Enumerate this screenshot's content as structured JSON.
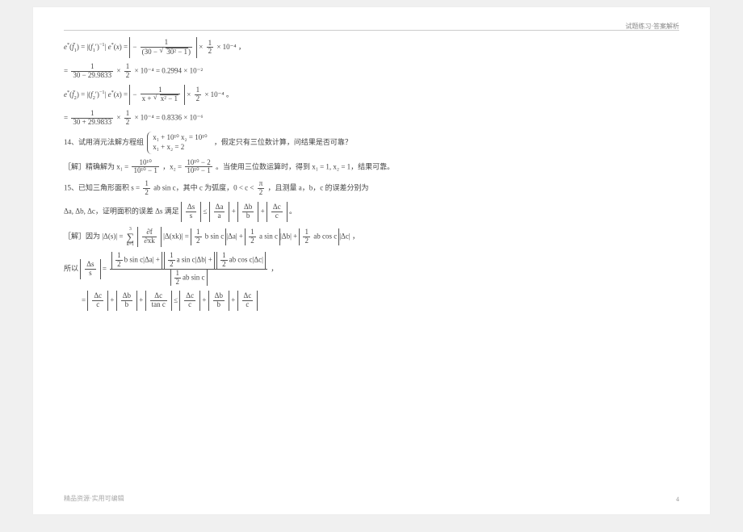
{
  "header": {
    "right": "试题练习·答案解析"
  },
  "footer": {
    "left": "精品资源·实用可编辑",
    "page": "4"
  },
  "eq1": {
    "lhs_a": "e",
    "lhs_sup_a": "*",
    "lhs_arg_a": "(f̄₁)",
    "mid_a": "= |(f₁')⁻¹| e",
    "mid_sup": "*",
    "mid_b": "(x) =",
    "big_num": "1",
    "big_den_a": "(30 − ",
    "big_den_sqrt": "30² − 1",
    "big_den_b": ")",
    "times": "×",
    "half_num": "1",
    "half_den": "2",
    "tenexp": "× 10⁻⁴",
    "punct": "，"
  },
  "eq1b": {
    "eq": "=",
    "f1_num": "1",
    "f1_den": "30 − 29.9833",
    "times": "×",
    "half_num": "1",
    "half_den": "2",
    "t4": "× 10⁻⁴ = 0.2994 × 10⁻²"
  },
  "eq2": {
    "lhs": "e*(f̄₂) = |(f₂')⁻¹| e*(x) =",
    "big_num": "1",
    "big_den_a": "x + ",
    "big_den_sqrt": "x² − 1",
    "times": "×",
    "half_num": "1",
    "half_den": "2",
    "tenexp": "× 10⁻⁴",
    "punct": "。"
  },
  "eq2b": {
    "eq": "=",
    "f1_num": "1",
    "f1_den": "30 + 29.9833",
    "times": "×",
    "half_num": "1",
    "half_den": "2",
    "t4": "× 10⁻⁴ = 0.8336 × 10⁻⁶"
  },
  "q14": {
    "label": "14、试用消元法解方程组",
    "sys_r1": "x₁ + 10¹⁰ x₂ = 10¹⁰",
    "sys_r2": "x₁ + x₂ = 2",
    "tail": "，假定只有三位数计算，问结果是否可靠？"
  },
  "a14": {
    "head": "［解］精确解为 x₁ =",
    "f1_num": "10¹⁰",
    "f1_den": "10¹⁰ − 1",
    "comma": "，x₂ =",
    "f2_num": "10¹⁰ − 2",
    "f2_den": "10¹⁰ − 1",
    "mid": "。当使用三位数运算时，得到 x₁ = 1, x₂ = 1，结果可靠。"
  },
  "q15": {
    "label": "15、已知三角形面积 s =",
    "half_num": "1",
    "half_den": "2",
    "body": "ab sin c，其中 c 为弧度，0 < c <",
    "pi_num": "π",
    "pi_den": "2",
    "tail": "，且测量 a，b，c 的误差分别为"
  },
  "q15b": {
    "deltas": "Δa, Δb, Δc，证明面积的误差 Δs 满足",
    "lhs_num": "Δs",
    "lhs_den": "s",
    "le": "≤",
    "t1_num": "Δa",
    "t1_den": "a",
    "plus": "+",
    "t2_num": "Δb",
    "t2_den": "b",
    "t3_num": "Δc",
    "t3_den": "c",
    "end": "。"
  },
  "p15a": {
    "head": "［解］因为 |Δ(s)| =",
    "sum_top": "3",
    "sum_bot": "k=1",
    "part_num": "∂f",
    "part_den": "∂xk",
    "mid": "|Δ(xk)| =",
    "half_num": "1",
    "half_den": "2",
    "t1": "b sin c",
    "d1": "|Δa|",
    "plus": "+",
    "t2": "a sin c",
    "d2": "|Δb|",
    "t3": "ab cos c",
    "d3": "|Δc|",
    "end": "，"
  },
  "p15b": {
    "prefix": "所以",
    "lhs_num": "Δs",
    "lhs_den": "s",
    "eq": "=",
    "big_num_t1_h_num": "1",
    "big_num_t1_h_den": "2",
    "big_num_t1": "b sin c|Δa| +",
    "big_num_t2_h_num": "1",
    "big_num_t2_h_den": "2",
    "big_num_t2": "a sin c|Δb| +",
    "big_num_t3_h_num": "1",
    "big_num_t3_h_den": "2",
    "big_num_t3": "ab cos c|Δc|",
    "big_den_h_num": "1",
    "big_den_h_den": "2",
    "big_den": "ab sin c",
    "end": "，"
  },
  "p15c": {
    "eq": "=",
    "t1_num": "Δc",
    "t1_den": "c",
    "plus": "+",
    "t2_num": "Δb",
    "t2_den": "b",
    "t3_num": "Δc",
    "t3_den": "tan c",
    "le": "≤",
    "r1_num": "Δc",
    "r1_den": "c",
    "r2_num": "Δb",
    "r2_den": "b",
    "r3_num": "Δc",
    "r3_den": "c"
  }
}
